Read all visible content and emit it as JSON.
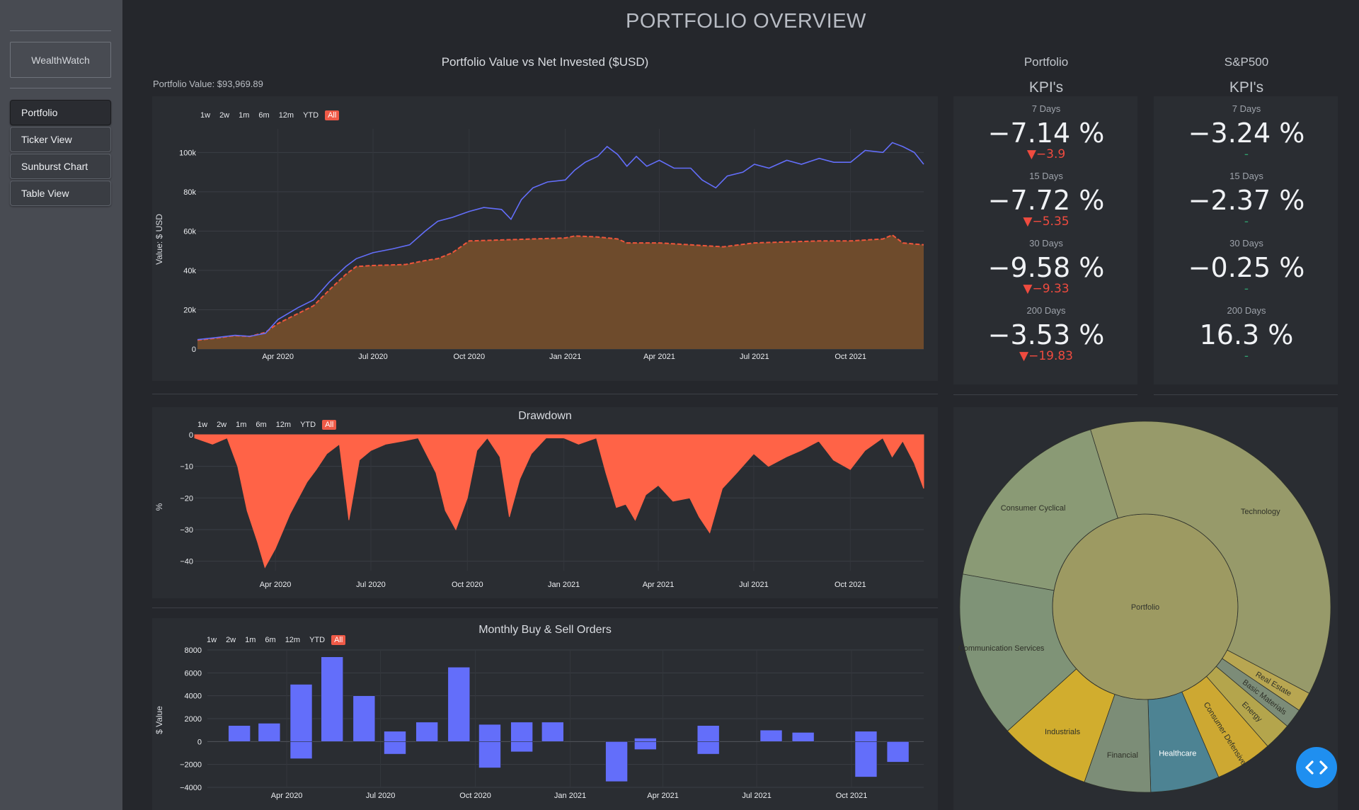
{
  "sidebar": {
    "brand": "WealthWatch",
    "items": [
      {
        "label": "Portfolio",
        "active": true
      },
      {
        "label": "Ticker View",
        "active": false
      },
      {
        "label": "Sunburst Chart",
        "active": false
      },
      {
        "label": "Table View",
        "active": false
      }
    ]
  },
  "page": {
    "title": "PORTFOLIO OVERVIEW"
  },
  "range_selector": [
    "1w",
    "2w",
    "1m",
    "6m",
    "12m",
    "YTD",
    "All"
  ],
  "range_selected": "All",
  "colors": {
    "value_line": "#636efa",
    "invested": "#ef553b",
    "drawdown": "#ff6347",
    "orders": "#636efa",
    "negative": "#ef4b3f",
    "neutral": "#2f9f6e",
    "fab": "#1f8ff0"
  },
  "chart_data": [
    {
      "id": "value",
      "type": "area",
      "title": "Portfolio Value vs Net Invested ($USD)",
      "subtitle": "Portfolio Value: $93,969.89",
      "ylabel": "Value: $ USD",
      "xlabel": "",
      "ylim": [
        0,
        112000
      ],
      "yticks": [
        0,
        20000,
        40000,
        60000,
        80000,
        100000
      ],
      "ytick_labels": [
        "0",
        "20k",
        "40k",
        "60k",
        "80k",
        "100k"
      ],
      "xlim": [
        "2020-01-15",
        "2021-12-10"
      ],
      "xticks": [
        "2020-04-01",
        "2020-07-01",
        "2020-10-01",
        "2021-01-01",
        "2021-04-01",
        "2021-07-01",
        "2021-10-01"
      ],
      "xtick_labels": [
        "Apr 2020",
        "Jul 2020",
        "Oct 2020",
        "Jan 2021",
        "Apr 2021",
        "Jul 2021",
        "Oct 2021"
      ],
      "series": [
        {
          "x": [
            "2020-01-15",
            "2020-02-01",
            "2020-02-20",
            "2020-03-05",
            "2020-03-20",
            "2020-04-01",
            "2020-04-20",
            "2020-05-05",
            "2020-05-20",
            "2020-06-05",
            "2020-06-15",
            "2020-07-01",
            "2020-07-20",
            "2020-08-05",
            "2020-08-20",
            "2020-09-01",
            "2020-09-15",
            "2020-10-01",
            "2020-10-15",
            "2020-11-01",
            "2020-11-10",
            "2020-11-20",
            "2020-12-01",
            "2020-12-15",
            "2021-01-01",
            "2021-01-10",
            "2021-01-20",
            "2021-02-01",
            "2021-02-10",
            "2021-02-20",
            "2021-03-01",
            "2021-03-10",
            "2021-03-20",
            "2021-04-01",
            "2021-04-15",
            "2021-05-01",
            "2021-05-12",
            "2021-05-25",
            "2021-06-05",
            "2021-06-20",
            "2021-07-01",
            "2021-07-15",
            "2021-08-01",
            "2021-08-15",
            "2021-09-01",
            "2021-09-15",
            "2021-10-01",
            "2021-10-15",
            "2021-11-01",
            "2021-11-10",
            "2021-11-20",
            "2021-12-01",
            "2021-12-10"
          ],
          "y": [
            4800,
            5800,
            7000,
            6500,
            8000,
            15000,
            21000,
            25000,
            34000,
            42000,
            46000,
            49000,
            51000,
            53000,
            60000,
            65000,
            67000,
            70000,
            72000,
            71000,
            66000,
            76000,
            82000,
            85000,
            86000,
            91000,
            95000,
            98000,
            103000,
            99000,
            93000,
            98000,
            93000,
            96000,
            92000,
            92000,
            86000,
            82000,
            88000,
            90000,
            94000,
            92000,
            96000,
            94000,
            97000,
            95000,
            95000,
            101000,
            100000,
            105000,
            103000,
            100000,
            94000
          ]
        },
        {
          "x": [
            "2020-01-15",
            "2020-02-01",
            "2020-02-20",
            "2020-03-05",
            "2020-03-20",
            "2020-04-01",
            "2020-04-20",
            "2020-05-05",
            "2020-05-20",
            "2020-06-05",
            "2020-06-15",
            "2020-07-01",
            "2020-08-01",
            "2020-08-20",
            "2020-09-01",
            "2020-09-15",
            "2020-10-01",
            "2020-11-01",
            "2020-12-01",
            "2021-01-01",
            "2021-01-10",
            "2021-02-01",
            "2021-02-20",
            "2021-03-01",
            "2021-04-01",
            "2021-05-01",
            "2021-06-01",
            "2021-07-01",
            "2021-08-01",
            "2021-09-01",
            "2021-10-01",
            "2021-11-01",
            "2021-11-10",
            "2021-11-20",
            "2021-12-10"
          ],
          "y": [
            4500,
            5500,
            6800,
            6400,
            8500,
            13000,
            18000,
            22000,
            30000,
            38000,
            42000,
            42500,
            43000,
            45000,
            46000,
            49000,
            55000,
            55500,
            56000,
            56500,
            57500,
            57000,
            56000,
            54000,
            54000,
            53000,
            52000,
            54000,
            54500,
            55000,
            55000,
            56000,
            58000,
            54000,
            53000
          ]
        }
      ]
    },
    {
      "id": "drawdown",
      "type": "area",
      "title": "Drawdown",
      "ylabel": "%",
      "xlabel": "",
      "ylim": [
        -43,
        0
      ],
      "yticks": [
        0,
        -10,
        -20,
        -30,
        -40
      ],
      "ytick_labels": [
        "0",
        "−10",
        "−20",
        "−30",
        "−40"
      ],
      "xlim": [
        "2020-01-15",
        "2021-12-10"
      ],
      "xticks": [
        "2020-04-01",
        "2020-07-01",
        "2020-10-01",
        "2021-01-01",
        "2021-04-01",
        "2021-07-01",
        "2021-10-01"
      ],
      "xtick_labels": [
        "Apr 2020",
        "Jul 2020",
        "Oct 2020",
        "Jan 2021",
        "Apr 2021",
        "Jul 2021",
        "Oct 2021"
      ],
      "series": [
        {
          "x": [
            "2020-01-15",
            "2020-02-01",
            "2020-02-15",
            "2020-02-25",
            "2020-03-05",
            "2020-03-15",
            "2020-03-22",
            "2020-04-01",
            "2020-04-15",
            "2020-05-01",
            "2020-05-10",
            "2020-05-20",
            "2020-06-01",
            "2020-06-10",
            "2020-06-20",
            "2020-07-01",
            "2020-07-15",
            "2020-08-01",
            "2020-08-15",
            "2020-09-01",
            "2020-09-10",
            "2020-09-20",
            "2020-10-01",
            "2020-10-10",
            "2020-10-20",
            "2020-11-01",
            "2020-11-10",
            "2020-11-20",
            "2020-12-01",
            "2020-12-15",
            "2021-01-01",
            "2021-01-15",
            "2021-02-01",
            "2021-02-10",
            "2021-02-20",
            "2021-03-01",
            "2021-03-10",
            "2021-03-20",
            "2021-04-01",
            "2021-04-15",
            "2021-05-01",
            "2021-05-10",
            "2021-05-20",
            "2021-06-01",
            "2021-06-15",
            "2021-07-01",
            "2021-07-15",
            "2021-08-01",
            "2021-08-15",
            "2021-09-01",
            "2021-09-15",
            "2021-10-01",
            "2021-10-15",
            "2021-11-01",
            "2021-11-10",
            "2021-11-20",
            "2021-12-01",
            "2021-12-10"
          ],
          "y": [
            -1,
            -3,
            -1,
            -10,
            -24,
            -34,
            -42,
            -36,
            -25,
            -15,
            -11,
            -6,
            -3,
            -27,
            -8,
            -5,
            -3,
            -2,
            -1,
            -12,
            -24,
            -30,
            -20,
            -5,
            -1,
            -7,
            -26,
            -14,
            -6,
            -1,
            -1,
            -3,
            -1,
            -12,
            -23,
            -22,
            -27,
            -19,
            -16,
            -21,
            -20,
            -26,
            -31,
            -17,
            -12,
            -6,
            -10,
            -7,
            -5,
            -2,
            -8,
            -11,
            -5,
            -1,
            -7,
            -2,
            -9,
            -17
          ]
        }
      ]
    },
    {
      "id": "orders",
      "type": "bar",
      "title": "Monthly Buy & Sell Orders",
      "ylabel": "$ Value",
      "xlabel": "",
      "ylim": [
        -4000,
        8000
      ],
      "yticks": [
        8000,
        6000,
        4000,
        2000,
        0,
        -2000,
        -4000
      ],
      "ytick_labels": [
        "8000",
        "6000",
        "4000",
        "2000",
        "0",
        "−2000",
        "−4000"
      ],
      "xlim": [
        "2020-01-15",
        "2021-12-10"
      ],
      "xticks": [
        "2020-04-01",
        "2020-07-01",
        "2020-10-01",
        "2021-01-01",
        "2021-04-01",
        "2021-07-01",
        "2021-10-01"
      ],
      "xtick_labels": [
        "Apr 2020",
        "Jul 2020",
        "Oct 2020",
        "Jan 2021",
        "Apr 2021",
        "Jul 2021",
        "Oct 2021"
      ],
      "categories": [
        "2020-02",
        "2020-03",
        "2020-04",
        "2020-05",
        "2020-06",
        "2020-07",
        "2020-08",
        "2020-09",
        "2020-10",
        "2020-11",
        "2020-12",
        "2021-01",
        "2021-02",
        "2021-03",
        "2021-04",
        "2021-05",
        "2021-06",
        "2021-07",
        "2021-08",
        "2021-09",
        "2021-10",
        "2021-11"
      ],
      "series": [
        {
          "name": "buy",
          "values": [
            1400,
            1600,
            5000,
            7400,
            4000,
            900,
            1700,
            6500,
            1500,
            1700,
            1700,
            0,
            0,
            300,
            0,
            1400,
            0,
            1000,
            800,
            0,
            900,
            0
          ]
        },
        {
          "name": "sell",
          "values": [
            0,
            0,
            -1500,
            0,
            0,
            -1100,
            0,
            0,
            -2300,
            -900,
            0,
            0,
            -3500,
            -700,
            0,
            -1100,
            0,
            0,
            0,
            0,
            -3100,
            -1800
          ]
        }
      ]
    },
    {
      "id": "sunburst",
      "type": "pie",
      "center": "Portfolio",
      "labels": [
        "Technology",
        "Real Estate",
        "Basic Materials",
        "Energy",
        "Consumer Defensive",
        "Healthcare",
        "Financial",
        "Industrials",
        "Communication Services",
        "Consumer Cyclical"
      ],
      "values": [
        37.5,
        1.7,
        1.7,
        2.4,
        5.0,
        6.0,
        5.8,
        8.0,
        14.5,
        17.4
      ],
      "colors": [
        "#979a6a",
        "#b8a651",
        "#7c8c78",
        "#b4a54c",
        "#cda832",
        "#4d8393",
        "#7c8d77",
        "#d1ad2e",
        "#7f9377",
        "#8a9a75"
      ]
    }
  ],
  "kpi": {
    "columns": [
      {
        "title": "Portfolio",
        "subtitle": "KPI's",
        "rows": [
          {
            "period": "7 Days",
            "value": "−7.14 %",
            "delta": "▼−3.9",
            "negative": true
          },
          {
            "period": "15 Days",
            "value": "−7.72 %",
            "delta": "▼−5.35",
            "negative": true
          },
          {
            "period": "30 Days",
            "value": "−9.58 %",
            "delta": "▼−9.33",
            "negative": true
          },
          {
            "period": "200 Days",
            "value": "−3.53 %",
            "delta": "▼−19.83",
            "negative": true
          }
        ]
      },
      {
        "title": "S&P500",
        "subtitle": "KPI's",
        "rows": [
          {
            "period": "7 Days",
            "value": "−3.24 %",
            "delta": "-",
            "negative": false
          },
          {
            "period": "15 Days",
            "value": "−2.37 %",
            "delta": "-",
            "negative": false
          },
          {
            "period": "30 Days",
            "value": "−0.25 %",
            "delta": "-",
            "negative": false
          },
          {
            "period": "200 Days",
            "value": "16.3 %",
            "delta": "-",
            "negative": false
          }
        ]
      }
    ]
  },
  "fab_icon": "code-brackets-icon"
}
